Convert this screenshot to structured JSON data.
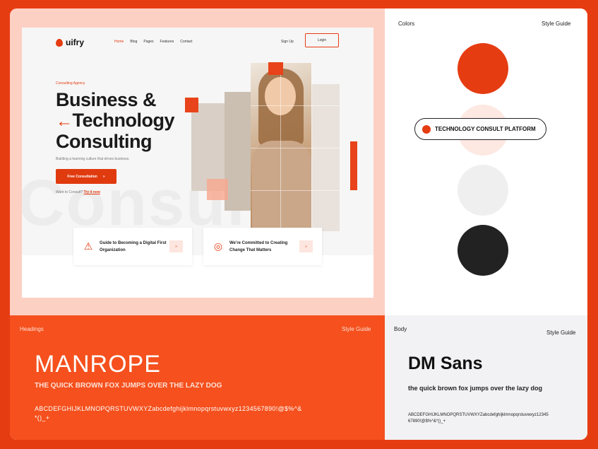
{
  "website": {
    "logo": "uifry",
    "nav": [
      "Home",
      "Blog",
      "Pages",
      "Features",
      "Contact"
    ],
    "signup": "Sign Up",
    "login": "Login",
    "eyebrow": "Consulting Agency",
    "headline_line1": "Business &",
    "headline_arrow": "←",
    "headline_line2": "Technology",
    "headline_line3": "Consulting",
    "subtitle": "Building a learning culture that drives business.",
    "cta": "Free Consultation",
    "cta_arrow": "»",
    "want_text": "Want to Consult?",
    "want_link": "Try it now",
    "cards": [
      {
        "text": "Guide to Becoming a Digital First Organization",
        "btn": "»"
      },
      {
        "text": "We're Committed to Creating Change That Matters",
        "btn": "»"
      }
    ]
  },
  "colors_panel": {
    "label": "Colors",
    "guide": "Style Guide",
    "swatches": [
      "#e63c12",
      "#fde8e2",
      "#efefef",
      "#222222"
    ],
    "pill_text": "TECHNOLOGY CONSULT PLATFORM"
  },
  "headings_panel": {
    "label": "Headings",
    "guide": "Style Guide",
    "font_name": "MANROPE",
    "pangram": "THE QUICK BROWN FOX JUMPS OVER THE LAZY DOG",
    "charset": "ABCDEFGHIJKLMNOPQRSTUVWXYZabcdefghijklmnopqrstuvwxyz1234567890!@$%^&*()_+"
  },
  "body_panel": {
    "label": "Body",
    "guide": "Style Guide",
    "font_name": "DM Sans",
    "pangram": "the quick brown fox jumps over the lazy dog",
    "charset": "ABCDEFGHIJKLMNOPQRSTUVWXYZabcdefghijklmnopqrstuvwxyz1234567890!@$%^&*()_+"
  }
}
